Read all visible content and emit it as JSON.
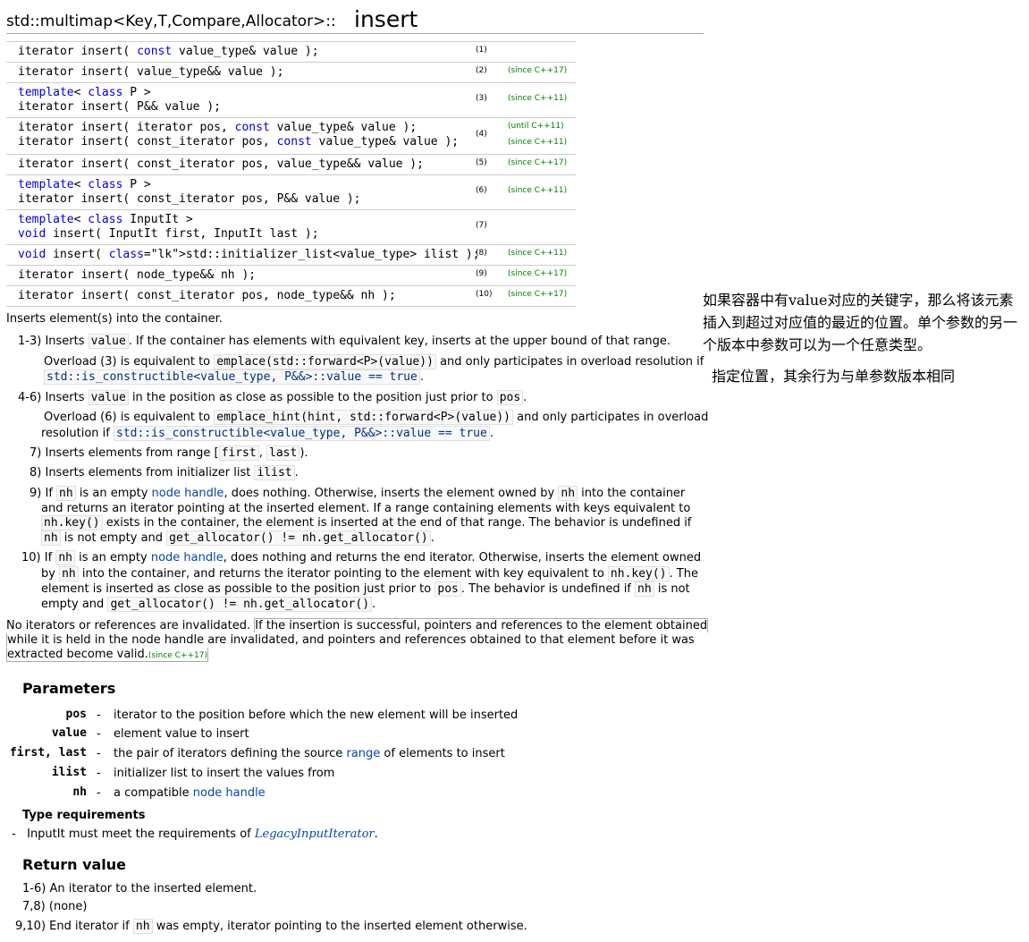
{
  "title": {
    "prefix": "std::multimap<Key,T,Compare,Allocator>::",
    "name": "insert"
  },
  "declarations": [
    {
      "num": "(1)",
      "since": "",
      "lines": [
        "iterator insert( const value_type& value );"
      ]
    },
    {
      "num": "(2)",
      "since": "(since C++17)",
      "lines": [
        "iterator insert( value_type&& value );"
      ]
    },
    {
      "num": "(3)",
      "since": "(since C++11)",
      "lines": [
        "template< class P >",
        "iterator insert( P&& value );"
      ]
    },
    {
      "num": "(4)",
      "since": "(until C++11)",
      "since2": "(since C++11)",
      "lines": [
        "iterator insert( iterator pos, const value_type& value );",
        "iterator insert( const_iterator pos, const value_type& value );"
      ]
    },
    {
      "num": "(5)",
      "since": "(since C++17)",
      "lines": [
        "iterator insert( const_iterator pos, value_type&& value );"
      ]
    },
    {
      "num": "(6)",
      "since": "(since C++11)",
      "lines": [
        "template< class P >",
        "iterator insert( const_iterator pos, P&& value );"
      ]
    },
    {
      "num": "(7)",
      "since": "",
      "lines": [
        "template< class InputIt >",
        "void insert( InputIt first, InputIt last );"
      ]
    },
    {
      "num": "(8)",
      "since": "(since C++11)",
      "lines": [
        "void insert( std::initializer_list<value_type> ilist );"
      ]
    },
    {
      "num": "(9)",
      "since": "(since C++17)",
      "lines": [
        "iterator insert( node_type&& nh );"
      ]
    },
    {
      "num": "(10)",
      "since": "(since C++17)",
      "lines": [
        "iterator insert( const_iterator pos, node_type&& nh );"
      ]
    }
  ],
  "intro": "Inserts element(s) into the container.",
  "items": {
    "i13_label": "1-3)",
    "i13_a": "Inserts",
    "i13_code": "value",
    "i13_b": ". If the container has elements with equivalent key, inserts at the upper bound of that range.",
    "o3_a": "Overload (3) is equivalent to",
    "o3_code": "emplace(std::forward<P>(value))",
    "o3_b": "and only participates in overload resolution if",
    "o3_code2": "std::is_constructible<value_type, P&&>::value == true",
    "o3_c": ".",
    "i46_label": "4-6)",
    "i46_a": "Inserts",
    "i46_code": "value",
    "i46_b": "in the position as close as possible to the position just prior to",
    "i46_code2": "pos",
    "i46_c": ".",
    "o6_a": "Overload (6) is equivalent to",
    "o6_code": "emplace_hint(hint, std::forward<P>(value))",
    "o6_b": "and only participates in overload",
    "o6_c": "resolution if",
    "o6_code2": "std::is_constructible<value_type, P&&>::value == true",
    "o6_d": ".",
    "i7_label": "7)",
    "i7_a": "Inserts elements from range [",
    "i7_code": "first",
    "i7_comma": ",",
    "i7_code2": "last",
    "i7_b": ").",
    "i8_label": "8)",
    "i8_a": "Inserts elements from initializer list",
    "i8_code": "ilist",
    "i8_b": ".",
    "i9_label": "9)",
    "i9_a": "If",
    "i9_code": "nh",
    "i9_b": "is an empty",
    "i9_link": "node handle",
    "i9_c": ", does nothing. Otherwise, inserts the element owned by",
    "i9_code2": "nh",
    "i9_d": "into the container",
    "i9_l2": "and returns an iterator pointing at the inserted element. If a range containing elements with keys equivalent to",
    "i9_code3": "nh.key()",
    "i9_l3": "exists in the container, the element is inserted at the end of that range. The behavior is undefined if",
    "i9_code4": "nh",
    "i9_l4": "is not empty and",
    "i9_code5": "get_allocator() != nh.get_allocator()",
    "i9_e": ".",
    "i10_label": "10)",
    "i10_a": "If",
    "i10_code": "nh",
    "i10_b": "is an empty",
    "i10_link": "node handle",
    "i10_c": ", does nothing and returns the end iterator. Otherwise, inserts the element owned",
    "i10_l2a": "by",
    "i10_code2": "nh",
    "i10_l2b": "into the container, and returns the iterator pointing to the element with key equivalent to",
    "i10_code3": "nh.key()",
    "i10_l2c": ". The",
    "i10_l3a": "element is inserted as close as possible to the position just prior to",
    "i10_code4": "pos",
    "i10_l3b": ". The behavior is undefined if",
    "i10_code5": "nh",
    "i10_l3c": "is not",
    "i10_l4a": "empty and",
    "i10_code6": "get_allocator() != nh.get_allocator()",
    "i10_l4b": "."
  },
  "invalidation": {
    "a": "No iterators or references are invalidated.",
    "b1": "If the insertion is successful, pointers and references to the element obtained",
    "b2": "while it is held in the node handle are invalidated, and pointers and references obtained to that element before it was",
    "b3": "extracted become valid.",
    "since": "(since C++17)"
  },
  "parameters": {
    "heading": "Parameters",
    "list": [
      {
        "name": "pos",
        "dash": "-",
        "desc": "iterator to the position before which the new element will be inserted"
      },
      {
        "name": "value",
        "dash": "-",
        "desc": "element value to insert"
      },
      {
        "name": "first, last",
        "dash": "-",
        "desc_a": "the pair of iterators defining the source",
        "link": "range",
        "desc_b": "of elements to insert"
      },
      {
        "name": "ilist",
        "dash": "-",
        "desc": "initializer list to insert the values from"
      },
      {
        "name": "nh",
        "dash": "-",
        "desc_a": "a compatible",
        "link": "node handle"
      }
    ],
    "type_req_heading": "Type requirements",
    "type_req_dash": "-",
    "type_req_a": "InputIt must meet the requirements of",
    "type_req_link": "LegacyInputIterator",
    "type_req_b": "."
  },
  "return_value": {
    "heading": "Return value",
    "r1_label": "1-6)",
    "r1": "An iterator to the inserted element.",
    "r2_label": "7,8)",
    "r2": "(none)",
    "r3_label": "9,10)",
    "r3_a": "End iterator if",
    "r3_code": "nh",
    "r3_b": "was empty, iterator pointing to the inserted element otherwise."
  },
  "note": {
    "p1": "如果容器中有value对应的关键字，那么将该元素插入到超过对应值的最近的位置。单个参数的另一个版本中参数可以为一个任意类型。",
    "p2": "指定位置，其余行为与单参数版本相同"
  }
}
